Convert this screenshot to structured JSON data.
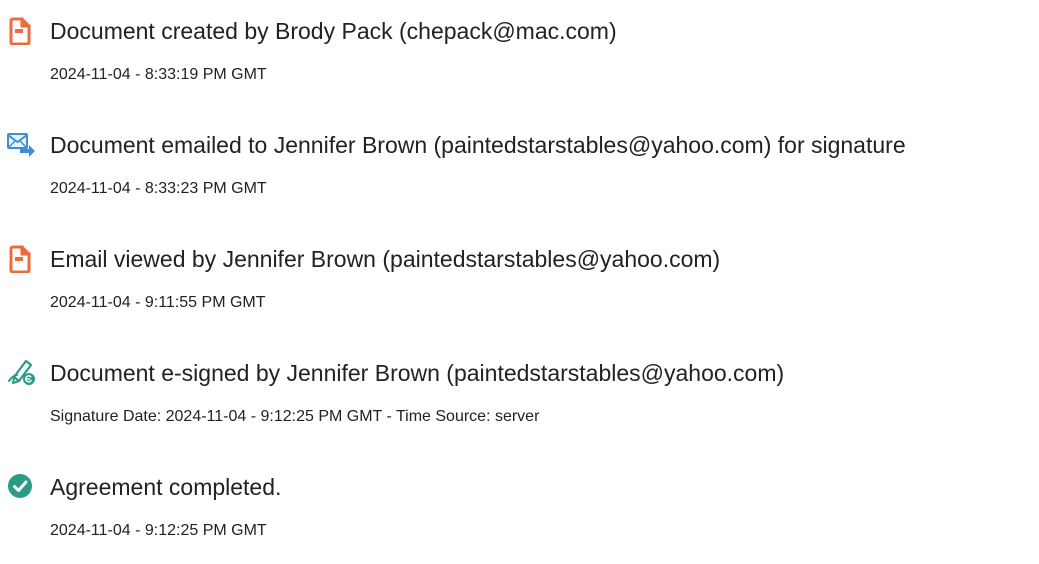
{
  "events": [
    {
      "icon": "document-icon",
      "title": "Document created by Brody Pack (chepack@mac.com)",
      "detail": "2024-11-04 - 8:33:19 PM GMT"
    },
    {
      "icon": "email-sent-icon",
      "title": "Document emailed to Jennifer Brown (paintedstarstables@yahoo.com) for signature",
      "detail": "2024-11-04 - 8:33:23 PM GMT"
    },
    {
      "icon": "document-icon",
      "title": "Email viewed by Jennifer Brown (paintedstarstables@yahoo.com)",
      "detail": "2024-11-04 - 9:11:55 PM GMT"
    },
    {
      "icon": "e-sign-pen-icon",
      "title": "Document e-signed by Jennifer Brown (paintedstarstables@yahoo.com)",
      "detail": "Signature Date: 2024-11-04 - 9:12:25 PM GMT - Time Source: server"
    },
    {
      "icon": "check-circle-icon",
      "title": "Agreement completed.",
      "detail": "2024-11-04 - 9:12:25 PM GMT"
    }
  ],
  "colors": {
    "document_icon": "#f06b3c",
    "email_icon": "#3d8fd8",
    "pen_icon": "#2a9c86",
    "check_icon": "#2a9c86",
    "text": "#222222"
  }
}
